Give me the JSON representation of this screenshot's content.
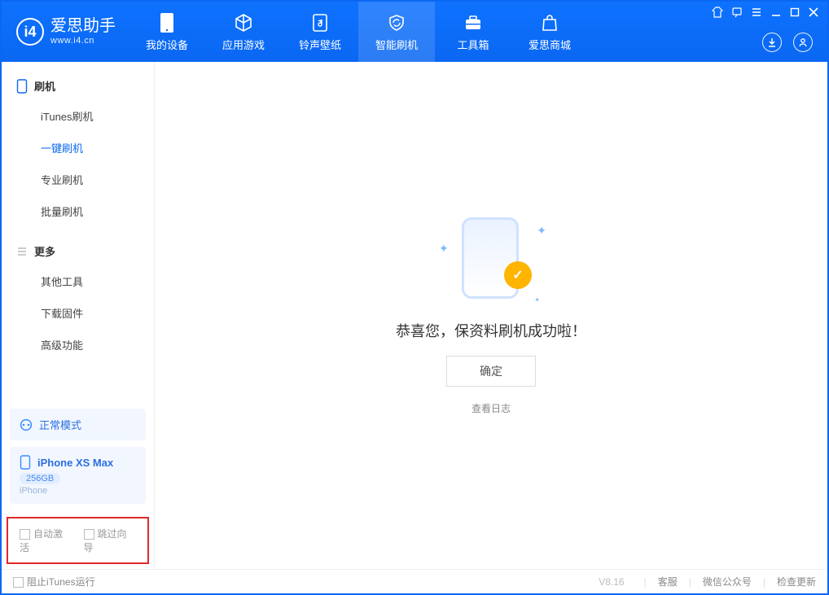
{
  "app": {
    "name": "爱思助手",
    "subtitle": "www.i4.cn"
  },
  "header": {
    "tabs": [
      {
        "label": "我的设备"
      },
      {
        "label": "应用游戏"
      },
      {
        "label": "铃声壁纸"
      },
      {
        "label": "智能刷机"
      },
      {
        "label": "工具箱"
      },
      {
        "label": "爱思商城"
      }
    ]
  },
  "sidebar": {
    "section1": {
      "title": "刷机",
      "items": [
        "iTunes刷机",
        "一键刷机",
        "专业刷机",
        "批量刷机"
      ]
    },
    "section2": {
      "title": "更多",
      "items": [
        "其他工具",
        "下载固件",
        "高级功能"
      ]
    },
    "mode_card": {
      "label": "正常模式"
    },
    "device_card": {
      "name": "iPhone XS Max",
      "storage": "256GB",
      "sub": "iPhone"
    },
    "checks": {
      "auto_activate": "自动激活",
      "skip_guide": "跳过向导"
    }
  },
  "main": {
    "message": "恭喜您，保资料刷机成功啦！",
    "ok": "确定",
    "view_log": "查看日志"
  },
  "footer": {
    "block_itunes": "阻止iTunes运行",
    "version": "V8.16",
    "links": [
      "客服",
      "微信公众号",
      "检查更新"
    ]
  }
}
